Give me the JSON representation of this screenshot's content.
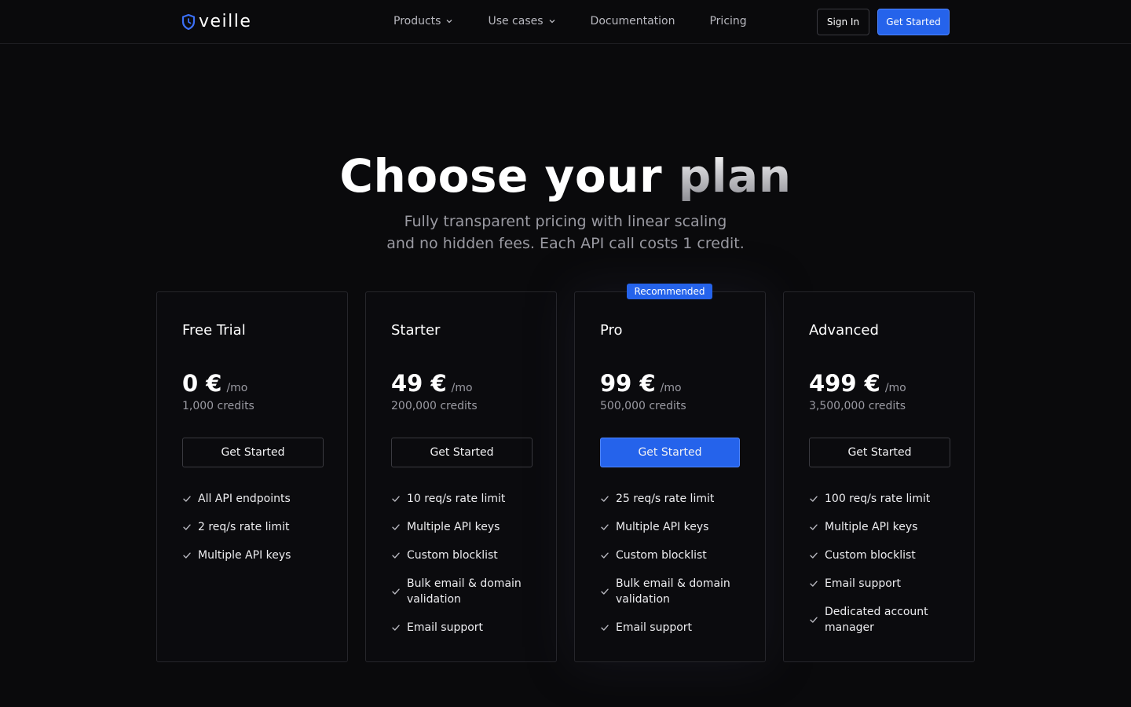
{
  "header": {
    "brand": "veille",
    "nav": [
      {
        "label": "Products",
        "dropdown": true
      },
      {
        "label": "Use cases",
        "dropdown": true
      },
      {
        "label": "Documentation",
        "dropdown": false
      },
      {
        "label": "Pricing",
        "dropdown": false
      }
    ],
    "sign_in_label": "Sign In",
    "get_started_label": "Get Started"
  },
  "hero": {
    "title_main": "Choose your",
    "title_accent": "plan",
    "subtitle_line1": "Fully transparent pricing with linear scaling",
    "subtitle_line2": "and no hidden fees. Each API call costs 1 credit."
  },
  "colors": {
    "accent": "#2563eb",
    "background": "#0a0a0c",
    "muted_text": "#9a9aa2"
  },
  "plans": [
    {
      "name": "Free Trial",
      "price": "0 €",
      "period": "/mo",
      "credits": "1,000 credits",
      "button": "Get Started",
      "recommended": false,
      "features": [
        "All API endpoints",
        "2 req/s rate limit",
        "Multiple API keys"
      ]
    },
    {
      "name": "Starter",
      "price": "49 €",
      "period": "/mo",
      "credits": "200,000 credits",
      "button": "Get Started",
      "recommended": false,
      "features": [
        "10 req/s rate limit",
        "Multiple API keys",
        "Custom blocklist",
        "Bulk email & domain validation",
        "Email support"
      ]
    },
    {
      "name": "Pro",
      "price": "99 €",
      "period": "/mo",
      "credits": "500,000 credits",
      "button": "Get Started",
      "recommended": true,
      "badge": "Recommended",
      "features": [
        "25 req/s rate limit",
        "Multiple API keys",
        "Custom blocklist",
        "Bulk email & domain validation",
        "Email support"
      ]
    },
    {
      "name": "Advanced",
      "price": "499 €",
      "period": "/mo",
      "credits": "3,500,000 credits",
      "button": "Get Started",
      "recommended": false,
      "features": [
        "100 req/s rate limit",
        "Multiple API keys",
        "Custom blocklist",
        "Email support",
        "Dedicated account manager"
      ]
    }
  ]
}
